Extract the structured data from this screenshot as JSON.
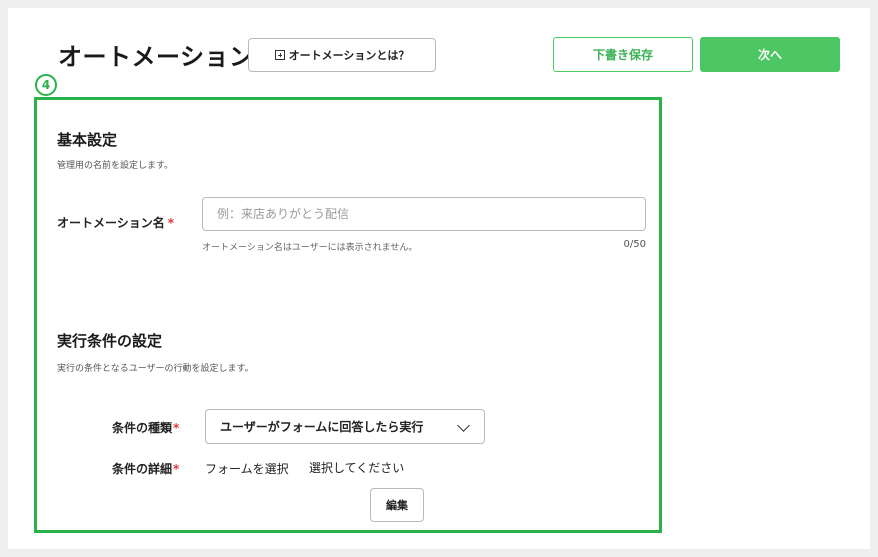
{
  "header": {
    "title": "オートメーション",
    "help_button": "オートメーションとは？",
    "draft_button": "下書き保存",
    "next_button": "次へ"
  },
  "annotation": {
    "step_number": "4",
    "highlight_color": "#2bb34a"
  },
  "basic_settings": {
    "title": "基本設定",
    "description": "管理用の名前を設定します。",
    "name_label": "オートメーション名",
    "required_mark": "*",
    "name_value": "",
    "name_placeholder": "例：来店ありがとう配信",
    "name_hint": "オートメーション名はユーザーには表示されません。",
    "name_counter": "0/50"
  },
  "trigger_settings": {
    "title": "実行条件の設定",
    "description": "実行の条件となるユーザーの行動を設定します。",
    "type_label": "条件の種類",
    "type_selected": "ユーザーがフォームに回答したら実行",
    "detail_label": "条件の詳細",
    "detail_field": "フォームを選択",
    "detail_value": "選択してください",
    "edit_button": "編集",
    "required_mark": "*"
  },
  "colors": {
    "accent": "#4cc764",
    "required": "#e0353c"
  },
  "icons": {
    "help": "plus-square-icon",
    "select": "chevron-down-icon"
  }
}
